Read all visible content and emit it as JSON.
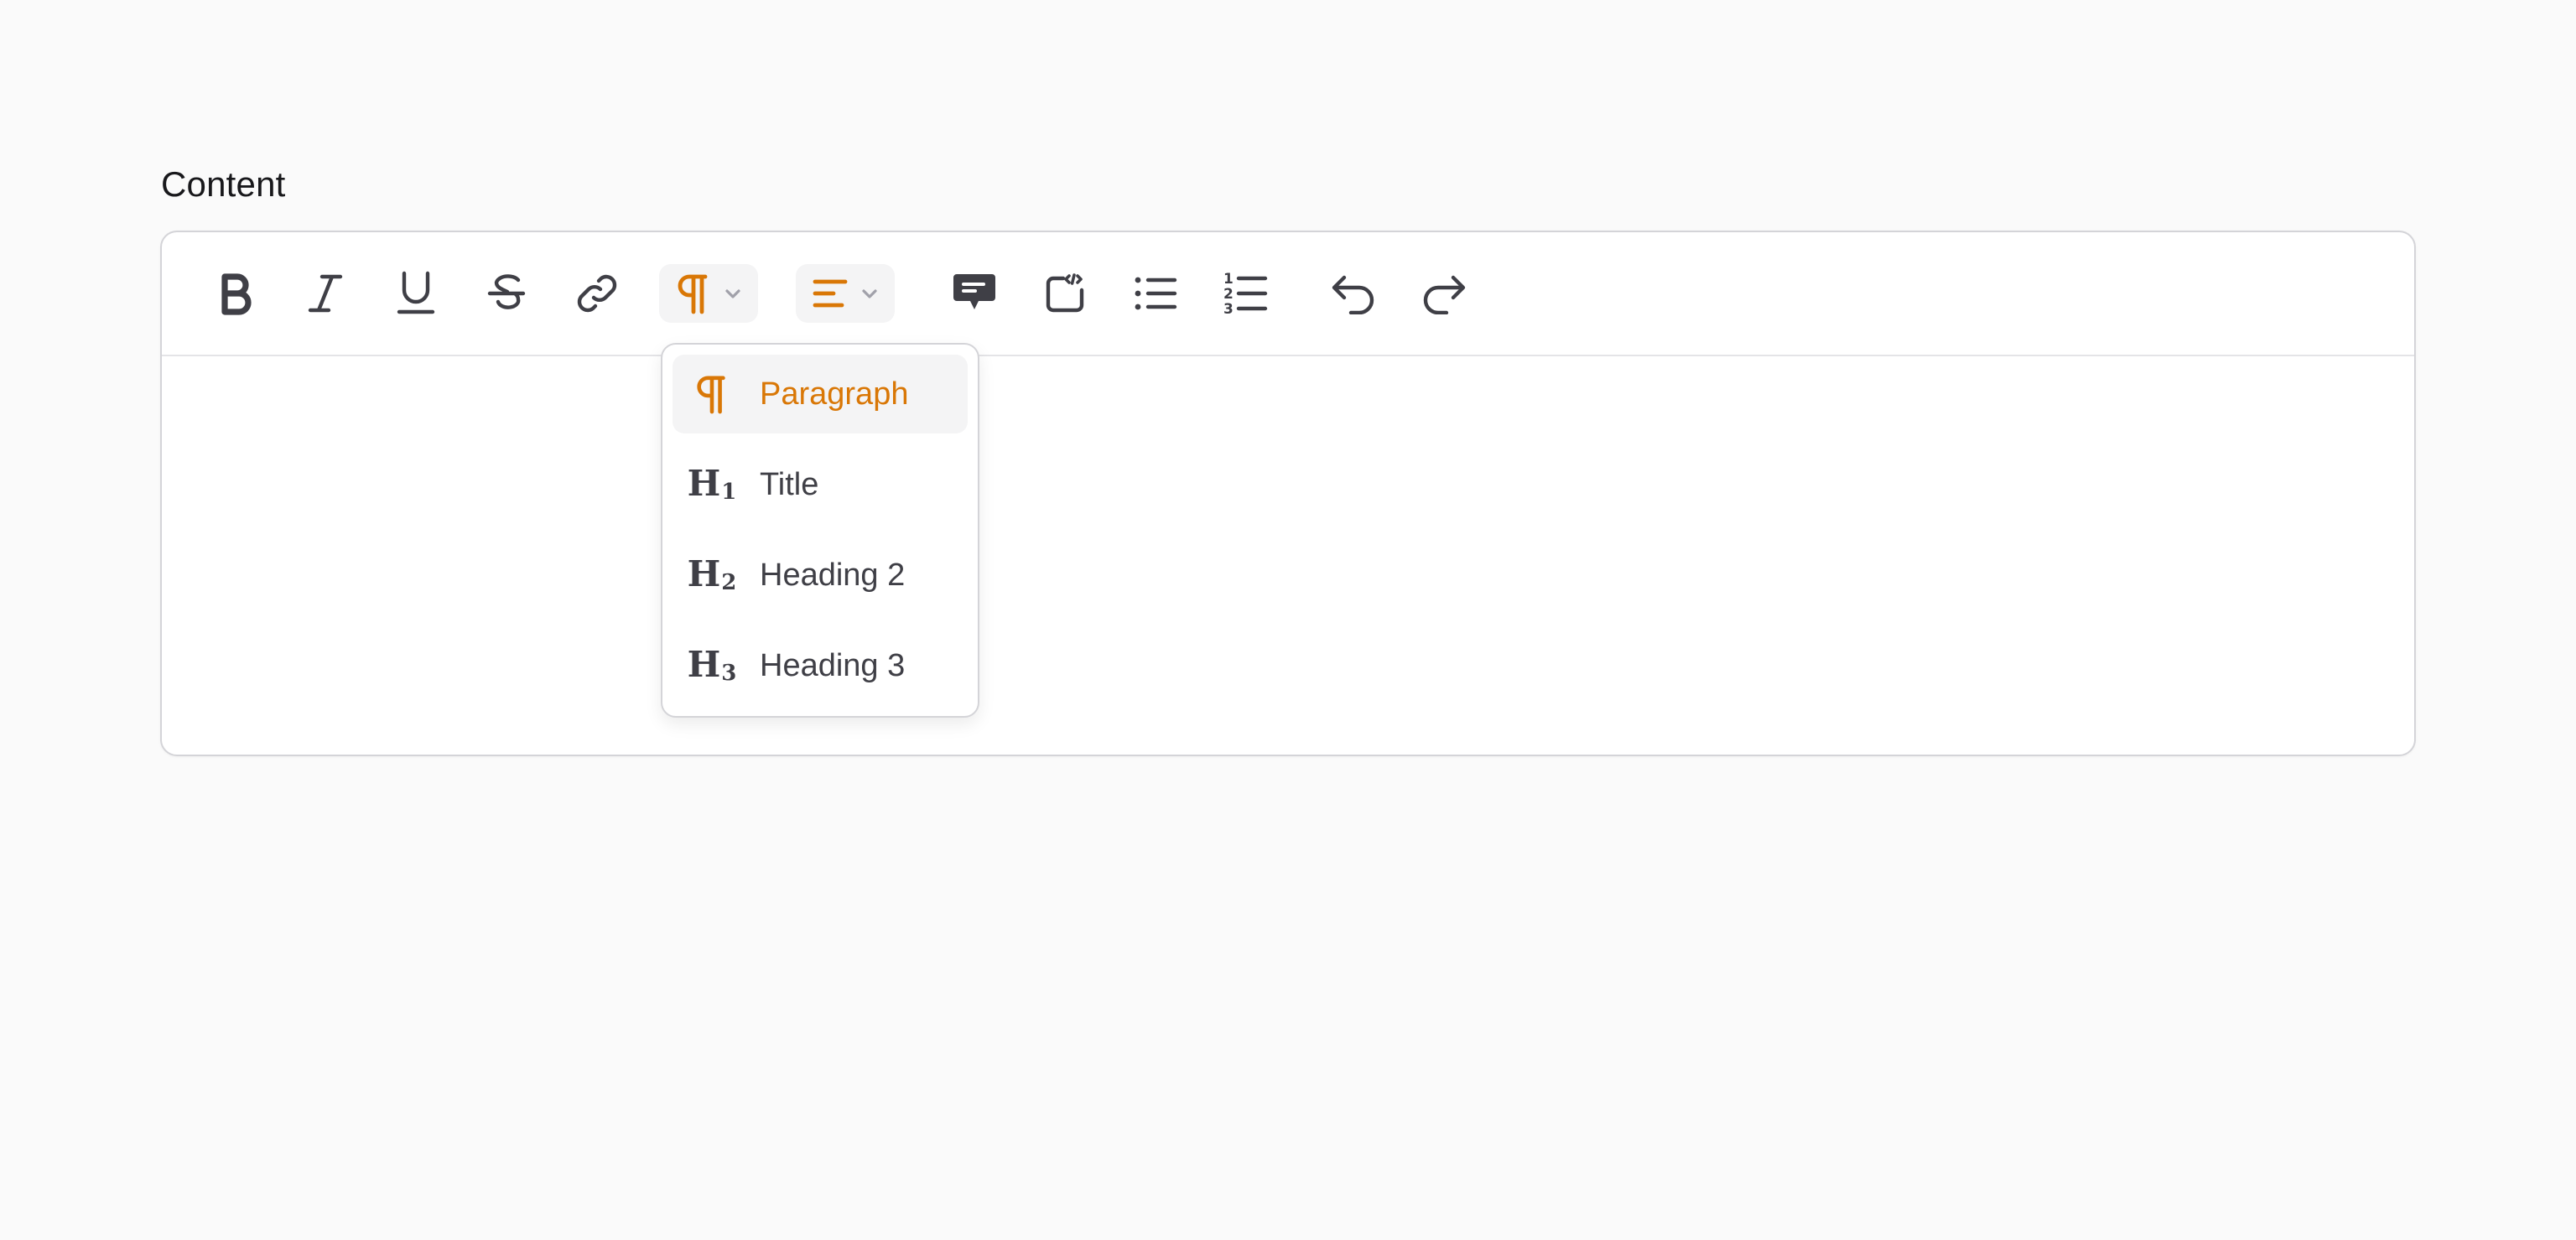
{
  "field": {
    "label": "Content"
  },
  "toolbar": {
    "buttons": [
      {
        "name": "bold",
        "icon": "bold-icon"
      },
      {
        "name": "italic",
        "icon": "italic-icon"
      },
      {
        "name": "underline",
        "icon": "underline-icon"
      },
      {
        "name": "strikethrough",
        "icon": "strikethrough-icon"
      },
      {
        "name": "link",
        "icon": "link-icon"
      },
      {
        "name": "block-format",
        "icon": "paragraph-icon",
        "active": true
      },
      {
        "name": "text-align",
        "icon": "align-left-icon",
        "active": true
      },
      {
        "name": "blockquote",
        "icon": "quote-bubble-icon"
      },
      {
        "name": "code-block",
        "icon": "code-block-icon"
      },
      {
        "name": "bullet-list",
        "icon": "bullet-list-icon"
      },
      {
        "name": "ordered-list",
        "icon": "ordered-list-icon"
      },
      {
        "name": "undo",
        "icon": "undo-icon"
      },
      {
        "name": "redo",
        "icon": "redo-icon"
      }
    ]
  },
  "format_menu": {
    "selected": "Paragraph",
    "items": [
      {
        "label": "Paragraph",
        "icon": "paragraph-icon",
        "active": true
      },
      {
        "label": "Title",
        "icon": "h1-icon",
        "glyph": "H",
        "sub": "1"
      },
      {
        "label": "Heading 2",
        "icon": "h2-icon",
        "glyph": "H",
        "sub": "2"
      },
      {
        "label": "Heading 3",
        "icon": "h3-icon",
        "glyph": "H",
        "sub": "3"
      }
    ]
  },
  "colors": {
    "accent": "#d97706",
    "icon": "#3f3f46",
    "background": "#fafafa",
    "border": "#d4d4d8"
  }
}
